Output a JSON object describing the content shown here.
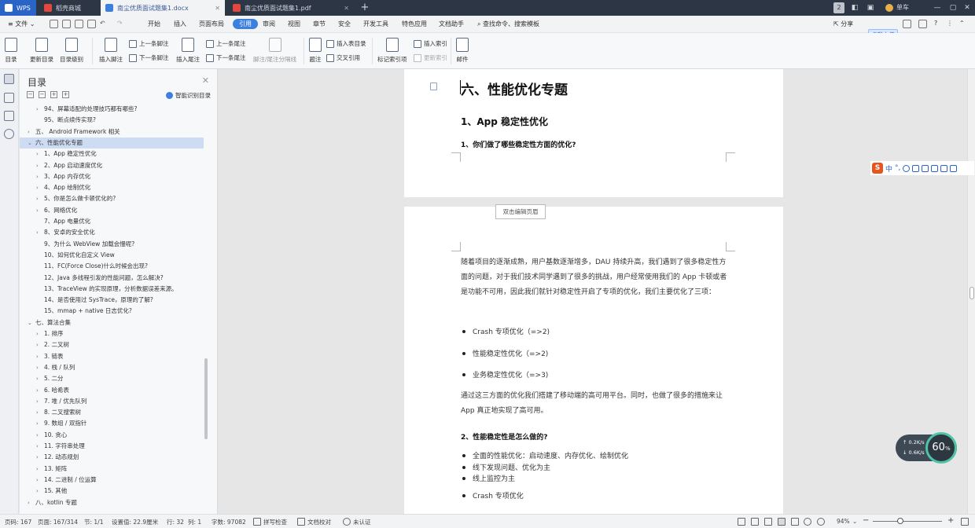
{
  "titlebar": {
    "tabs": [
      {
        "label": "WPS",
        "color": "#2b64c7"
      },
      {
        "label": "稻壳商城",
        "color": "#e2483d"
      },
      {
        "label": "南尘优质面试题集1.docx",
        "color": "#3b7fe0"
      },
      {
        "label": "南尘优质面试题集1.pdf",
        "color": "#e2483d"
      }
    ],
    "new_tab": "+",
    "badge": "2",
    "user": "单车",
    "upload": "点我上传"
  },
  "menubar": {
    "file": "文件",
    "items": [
      "开始",
      "插入",
      "页面布局",
      "引用",
      "审阅",
      "视图",
      "章节",
      "安全",
      "开发工具",
      "特色应用",
      "文档助手"
    ],
    "active": "引用",
    "search": "查找命令、搜索模板",
    "share": "分享"
  },
  "ribbon": {
    "toc": "目录",
    "update_toc": "更新目录",
    "toc_level": "目录级别",
    "insert_footnote": "插入脚注",
    "prev_footnote": "上一条脚注",
    "next_footnote": "下一条脚注",
    "insert_endnote": "插入尾注",
    "prev_endnote": "上一条尾注",
    "next_endnote": "下一条尾注",
    "footnote_sep": "脚注/尾注分隔线",
    "caption": "题注",
    "insert_figure_toc": "插入表目录",
    "cross_ref": "交叉引用",
    "mark_index": "标记索引项",
    "insert_index": "插入索引",
    "update_index": "更新索引",
    "mail": "邮件"
  },
  "toc": {
    "title": "目录",
    "smart": "智能识别目录",
    "items": [
      {
        "arrow": "›",
        "text": "94、屏幕适配的处理技巧都有哪些?",
        "indent": 2
      },
      {
        "arrow": "",
        "text": "95、断点续传实现?",
        "indent": 2
      },
      {
        "arrow": "›",
        "text": "五、 Android Framework 相关",
        "indent": 1
      },
      {
        "arrow": "⌄",
        "text": "六、性能优化专题",
        "indent": 1,
        "selected": true
      },
      {
        "arrow": "›",
        "text": "1、App 稳定性优化",
        "indent": 2
      },
      {
        "arrow": "›",
        "text": "2、App 启动速度优化",
        "indent": 2
      },
      {
        "arrow": "›",
        "text": "3、App 内存优化",
        "indent": 2
      },
      {
        "arrow": "›",
        "text": "4、App 绘制优化",
        "indent": 2
      },
      {
        "arrow": "›",
        "text": "5、你是怎么做卡顿优化的?",
        "indent": 2
      },
      {
        "arrow": "›",
        "text": "6、网络优化",
        "indent": 2
      },
      {
        "arrow": "",
        "text": "7、App 电量优化",
        "indent": 2
      },
      {
        "arrow": "›",
        "text": "8、安卓的安全优化",
        "indent": 2
      },
      {
        "arrow": "",
        "text": "9、为什么 WebView 加载会慢呢?",
        "indent": 2
      },
      {
        "arrow": "",
        "text": "10、如何优化自定义 View",
        "indent": 2
      },
      {
        "arrow": "",
        "text": "11、FC(Force Close)什么时候会出现?",
        "indent": 2
      },
      {
        "arrow": "",
        "text": "12、Java 多线程引发的性能问题，怎么解决?",
        "indent": 2
      },
      {
        "arrow": "",
        "text": "13、TraceView 的实现原理，分析数据误差来源。",
        "indent": 2
      },
      {
        "arrow": "",
        "text": "14、是否使用过 SysTrace，原理的了解?",
        "indent": 2
      },
      {
        "arrow": "",
        "text": "15、mmap + native 日志优化?",
        "indent": 2
      },
      {
        "arrow": "⌄",
        "text": "七、算法合集",
        "indent": 1
      },
      {
        "arrow": "›",
        "text": "1. 排序",
        "indent": 2
      },
      {
        "arrow": "›",
        "text": "2. 二叉树",
        "indent": 2
      },
      {
        "arrow": "›",
        "text": "3. 链表",
        "indent": 2
      },
      {
        "arrow": "›",
        "text": "4. 栈 / 队列",
        "indent": 2
      },
      {
        "arrow": "›",
        "text": "5. 二分",
        "indent": 2
      },
      {
        "arrow": "›",
        "text": "6. 哈希表",
        "indent": 2
      },
      {
        "arrow": "›",
        "text": "7. 堆 / 优先队列",
        "indent": 2
      },
      {
        "arrow": "›",
        "text": "8. 二叉搜索树",
        "indent": 2
      },
      {
        "arrow": "›",
        "text": "9. 数组 / 双指针",
        "indent": 2
      },
      {
        "arrow": "›",
        "text": "10. 贪心",
        "indent": 2
      },
      {
        "arrow": "›",
        "text": "11. 字符串处理",
        "indent": 2
      },
      {
        "arrow": "›",
        "text": "12. 动态规划",
        "indent": 2
      },
      {
        "arrow": "›",
        "text": "13. 矩阵",
        "indent": 2
      },
      {
        "arrow": "›",
        "text": "14. 二进制 / 位运算",
        "indent": 2
      },
      {
        "arrow": "›",
        "text": "15. 其他",
        "indent": 2
      },
      {
        "arrow": "›",
        "text": "八、kotlin 专题",
        "indent": 1
      }
    ]
  },
  "document": {
    "heading_main": "六、性能优化专题",
    "heading_1": "1、App 稳定性优化",
    "heading_q1": "1、你们做了哪些稳定性方面的优化?",
    "header_edit": "双击编辑页眉",
    "para_1": "随着项目的逐渐成熟，用户基数逐渐增多，DAU 持续升高，我们遇到了很多稳定性方面的问题，对于我们技术同学遇到了很多的挑战，用户经常使用我们的 App 卡顿或者是功能不可用，因此我们就针对稳定性开启了专项的优化，我们主要优化了三项：",
    "bullets_1": [
      "Crash 专项优化（=>2)",
      "性能稳定性优化（=>2)",
      "业务稳定性优化（=>3)"
    ],
    "para_2": "通过这三方面的优化我们搭建了移动端的高可用平台。同时，也做了很多的措施来让 App 真正地实现了高可用。",
    "heading_q2": "2、性能稳定性是怎么做的?",
    "bullets_2": [
      "全面的性能优化：启动速度、内存优化、绘制优化",
      "线下发现问题、优化为主",
      "线上监控为主",
      "Crash 专项优化"
    ]
  },
  "ime": {
    "lang": "中"
  },
  "speed": {
    "up": "0.2",
    "down": "0.6",
    "unit": "K/s",
    "percent": "60",
    "percent_unit": "%"
  },
  "status": {
    "page": "页码: 167",
    "pages": "页面: 167/314",
    "section": "节: 1/1",
    "setting": "设置值: 22.9厘米",
    "row": "行: 32",
    "col": "列: 1",
    "words": "字数: 97082",
    "spell": "拼写检查",
    "proof": "文档校对",
    "cert": "未认证",
    "zoom": "94%",
    "zoom_fraction": 0.4
  }
}
